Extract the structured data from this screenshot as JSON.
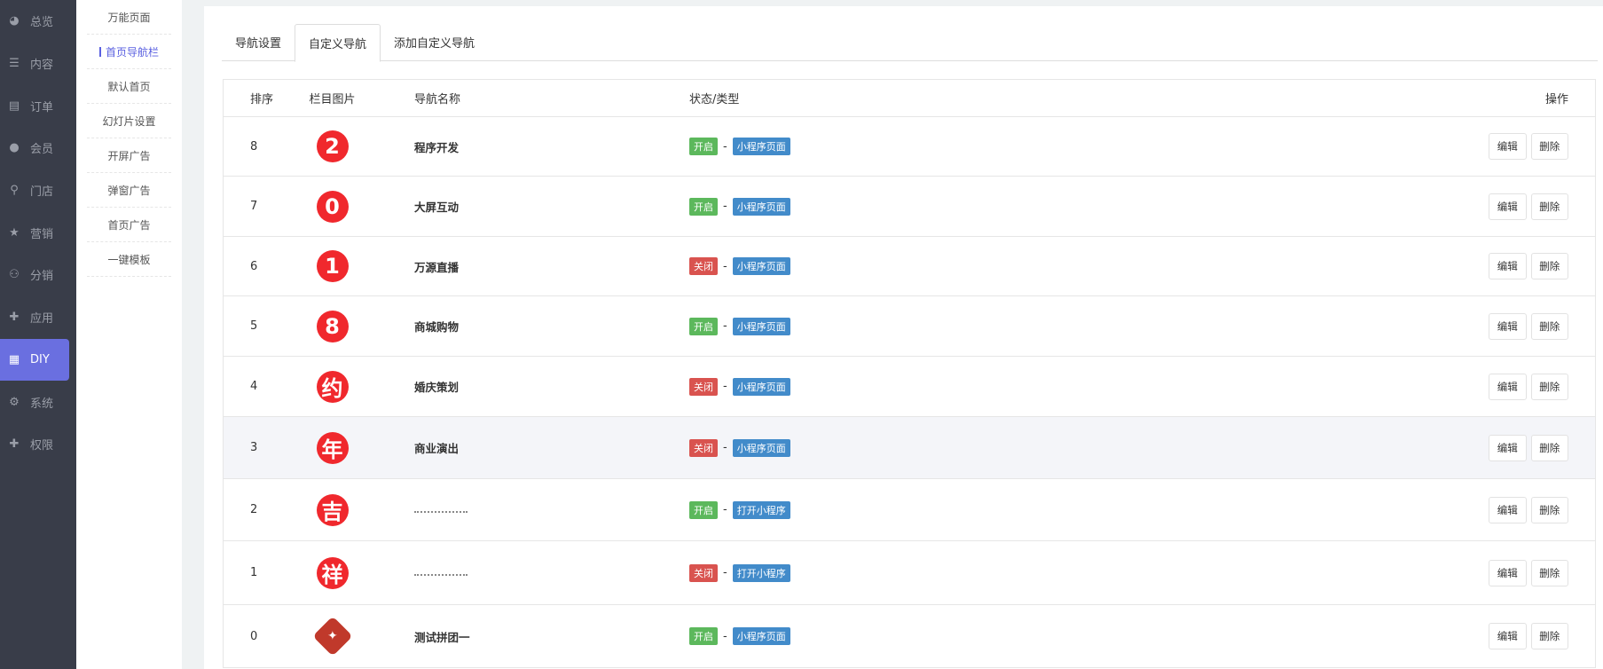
{
  "sidebar": {
    "items": [
      {
        "label": "总览",
        "icon": "pie-chart-icon"
      },
      {
        "label": "内容",
        "icon": "list-icon"
      },
      {
        "label": "订单",
        "icon": "document-icon"
      },
      {
        "label": "会员",
        "icon": "user-icon"
      },
      {
        "label": "门店",
        "icon": "location-icon"
      },
      {
        "label": "营销",
        "icon": "star-icon"
      },
      {
        "label": "分销",
        "icon": "users-icon"
      },
      {
        "label": "应用",
        "icon": "puzzle-icon"
      },
      {
        "label": "DIY",
        "icon": "layout-icon",
        "active": true
      },
      {
        "label": "系统",
        "icon": "gear-icon"
      },
      {
        "label": "权限",
        "icon": "user-plus-icon"
      }
    ]
  },
  "submenu": {
    "items": [
      "万能页面",
      "首页导航栏",
      "默认首页",
      "幻灯片设置",
      "开屏广告",
      "弹窗广告",
      "首页广告",
      "一键模板"
    ],
    "active": 1
  },
  "tabs": [
    "导航设置",
    "自定义导航",
    "添加自定义导航"
  ],
  "table": {
    "headers": [
      "排序",
      "栏目图片",
      "导航名称",
      "状态/类型",
      "操作"
    ],
    "rows": [
      {
        "order": "8",
        "img": "2",
        "name": "程序开发",
        "status": "开启",
        "type": "小程序页面"
      },
      {
        "order": "7",
        "img": "0",
        "name": "大屏互动",
        "status": "开启",
        "type": "小程序页面"
      },
      {
        "order": "6",
        "img": "1",
        "name": "万源直播",
        "status": "关闭",
        "type": "小程序页面"
      },
      {
        "order": "5",
        "img": "8",
        "name": "商城购物",
        "status": "开启",
        "type": "小程序页面"
      },
      {
        "order": "4",
        "img": "约",
        "name": "婚庆策划",
        "status": "关闭",
        "type": "小程序页面"
      },
      {
        "order": "3",
        "img": "年",
        "name": "商业演出",
        "status": "关闭",
        "type": "小程序页面"
      },
      {
        "order": "2",
        "img": "吉",
        "name": "",
        "status": "开启",
        "type": "打开小程序"
      },
      {
        "order": "1",
        "img": "祥",
        "name": "",
        "status": "关闭",
        "type": "打开小程序"
      },
      {
        "order": "0",
        "img": "logo",
        "name": "测试拼团一",
        "status": "开启",
        "type": "小程序页面"
      }
    ],
    "edit_label": "编辑",
    "delete_label": "删除"
  },
  "colors": {
    "on": "#5cb85c",
    "off": "#d9534f",
    "type": "#428bca",
    "accent": "#6a6fe0"
  }
}
